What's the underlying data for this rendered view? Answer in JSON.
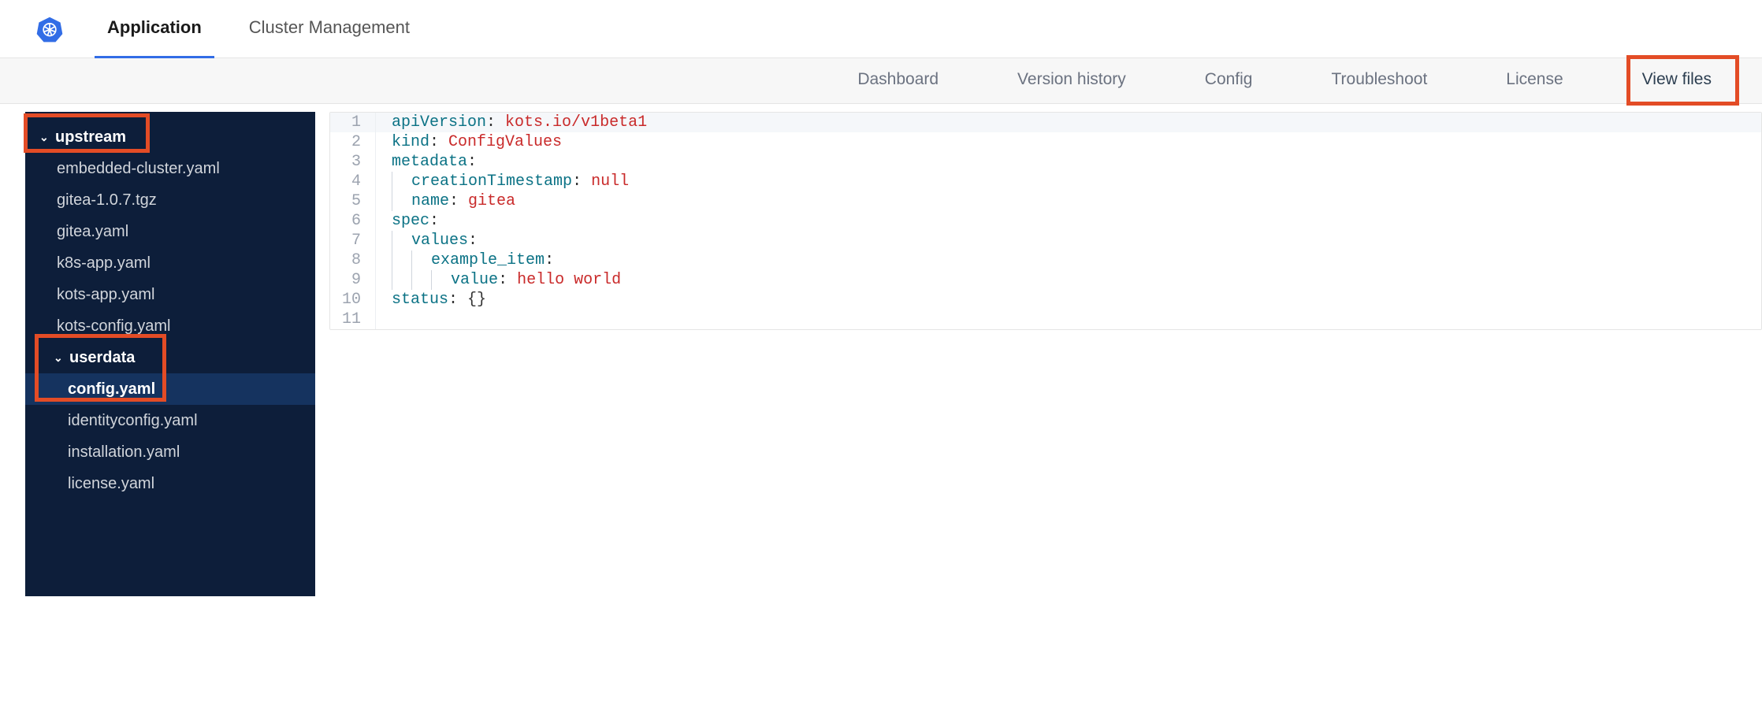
{
  "top_nav": {
    "application": "Application",
    "cluster_management": "Cluster Management"
  },
  "sub_nav": {
    "dashboard": "Dashboard",
    "version_history": "Version history",
    "config": "Config",
    "troubleshoot": "Troubleshoot",
    "license": "License",
    "view_files": "View files"
  },
  "sidebar": {
    "upstream": {
      "label": "upstream",
      "files": {
        "embedded_cluster": "embedded-cluster.yaml",
        "gitea_tgz": "gitea-1.0.7.tgz",
        "gitea_yaml": "gitea.yaml",
        "k8s_app": "k8s-app.yaml",
        "kots_app": "kots-app.yaml",
        "kots_config": "kots-config.yaml"
      },
      "userdata": {
        "label": "userdata",
        "files": {
          "config": "config.yaml",
          "identityconfig": "identityconfig.yaml",
          "installation": "installation.yaml",
          "license": "license.yaml"
        }
      }
    }
  },
  "editor": {
    "lines": {
      "l1": {
        "num": "1",
        "key": "apiVersion",
        "val": "kots.io/v1beta1"
      },
      "l2": {
        "num": "2",
        "key": "kind",
        "val": "ConfigValues"
      },
      "l3": {
        "num": "3",
        "key": "metadata"
      },
      "l4": {
        "num": "4",
        "key": "creationTimestamp",
        "val": "null"
      },
      "l5": {
        "num": "5",
        "key": "name",
        "val": "gitea"
      },
      "l6": {
        "num": "6",
        "key": "spec"
      },
      "l7": {
        "num": "7",
        "key": "values"
      },
      "l8": {
        "num": "8",
        "key": "example_item"
      },
      "l9": {
        "num": "9",
        "key": "value",
        "val": "hello world"
      },
      "l10": {
        "num": "10",
        "key": "status",
        "val": "{}"
      },
      "l11": {
        "num": "11"
      }
    }
  }
}
